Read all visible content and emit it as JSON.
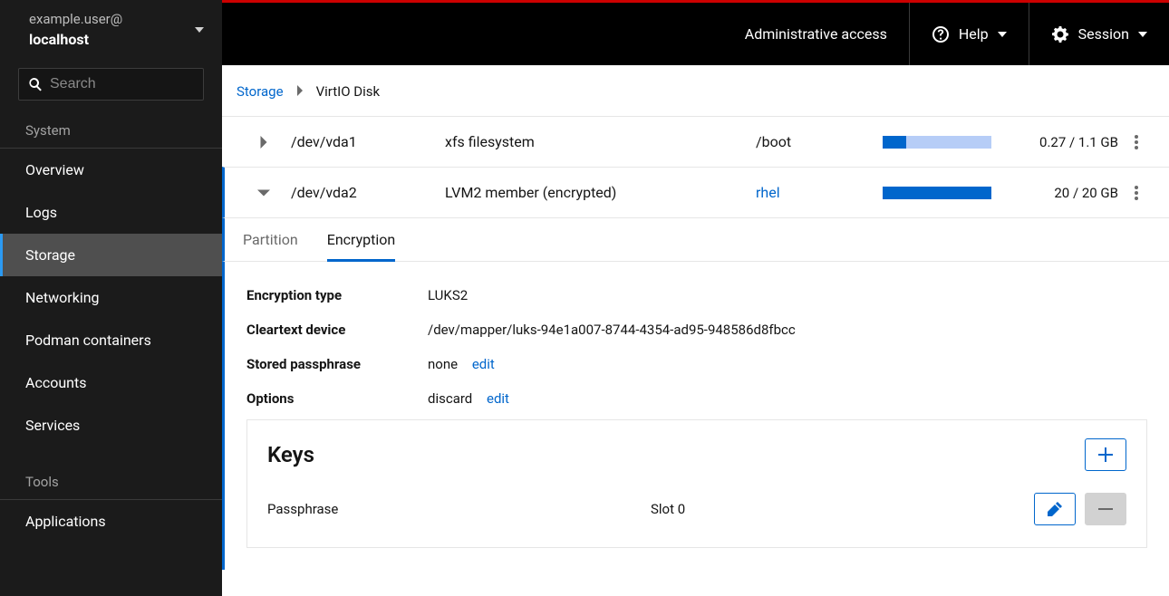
{
  "sidebar": {
    "user_line1": "example.user@",
    "user_line2": "localhost",
    "search_placeholder": "Search",
    "section_system": "System",
    "section_tools": "Tools",
    "nav": {
      "overview": "Overview",
      "logs": "Logs",
      "storage": "Storage",
      "networking": "Networking",
      "podman": "Podman containers",
      "accounts": "Accounts",
      "services": "Services",
      "applications": "Applications"
    }
  },
  "topbar": {
    "admin": "Administrative access",
    "help": "Help",
    "session": "Session"
  },
  "breadcrumbs": {
    "root": "Storage",
    "current": "VirtIO Disk"
  },
  "partitions": [
    {
      "device": "/dev/vda1",
      "desc": "xfs filesystem",
      "mount": "/boot",
      "mount_is_link": false,
      "usage_pct": 22,
      "usage_text": "0.27 / 1.1 GB",
      "expanded": false
    },
    {
      "device": "/dev/vda2",
      "desc": "LVM2 member (encrypted)",
      "mount": "rhel",
      "mount_is_link": true,
      "usage_pct": 100,
      "usage_text": "20 / 20 GB",
      "expanded": true
    }
  ],
  "tabs": {
    "partition": "Partition",
    "encryption": "Encryption"
  },
  "encryption": {
    "labels": {
      "type": "Encryption type",
      "cleartext": "Cleartext device",
      "stored": "Stored passphrase",
      "options": "Options"
    },
    "type": "LUKS2",
    "cleartext": "/dev/mapper/luks-94e1a007-8744-4354-ad95-948586d8fbcc",
    "stored_value": "none",
    "options_value": "discard",
    "edit_label": "edit"
  },
  "keys": {
    "heading": "Keys",
    "col1": "Passphrase",
    "col2": "Slot 0"
  }
}
